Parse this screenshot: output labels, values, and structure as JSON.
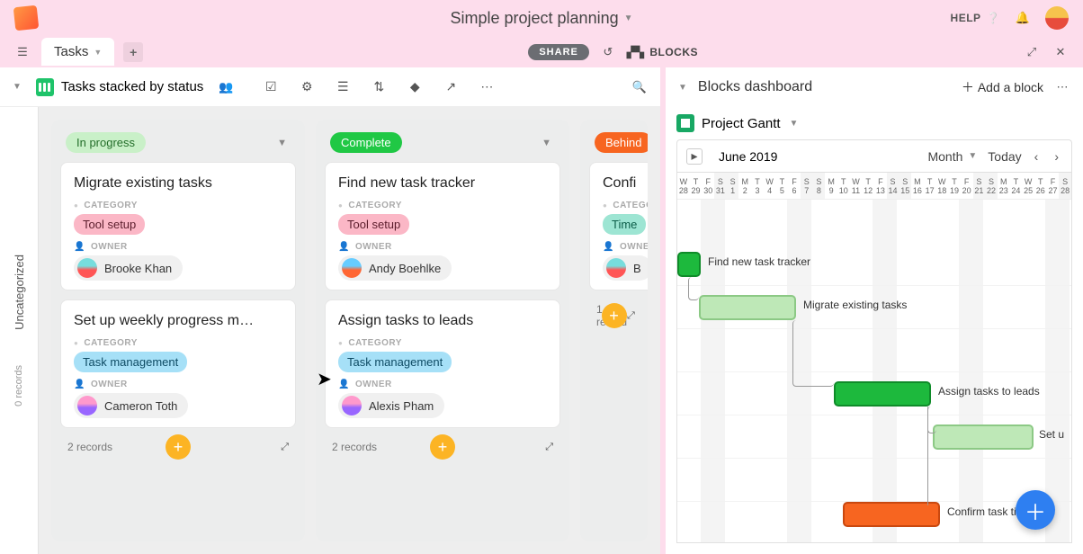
{
  "app": {
    "title": "Simple project planning",
    "help_label": "HELP"
  },
  "tabs": {
    "active": "Tasks"
  },
  "secondbar": {
    "share": "SHARE",
    "blocks": "BLOCKS"
  },
  "view": {
    "title": "Tasks stacked by status",
    "uncategorized": "Uncategorized",
    "uncat_records": "0 records"
  },
  "labels": {
    "category": "CATEGORY",
    "owner": "OWNER"
  },
  "columns": [
    {
      "status": "In progress",
      "statusClass": "pill-progress",
      "cards": [
        {
          "title": "Migrate existing tasks",
          "category": "Tool setup",
          "catClass": "cat-tool",
          "owner": "Brooke Khan",
          "avClass": "b"
        },
        {
          "title": "Set up weekly progress m…",
          "category": "Task management",
          "catClass": "cat-task",
          "owner": "Cameron Toth",
          "avClass": "c"
        }
      ],
      "footer": "2 records"
    },
    {
      "status": "Complete",
      "statusClass": "pill-complete",
      "cards": [
        {
          "title": "Find new task tracker",
          "category": "Tool setup",
          "catClass": "cat-tool",
          "owner": "Andy Boehlke",
          "avClass": "d"
        },
        {
          "title": "Assign tasks to leads",
          "category": "Task management",
          "catClass": "cat-task",
          "owner": "Alexis Pham",
          "avClass": "c"
        }
      ],
      "footer": "2 records"
    },
    {
      "status": "Behind",
      "statusClass": "pill-behind",
      "cards": [
        {
          "title": "Confi",
          "category": "Time",
          "catClass": "cat-time",
          "owner": "B",
          "avClass": "b"
        }
      ],
      "footer": "1 record"
    }
  ],
  "rightPanel": {
    "title": "Blocks dashboard",
    "add": "Add a block",
    "blockTitle": "Project Gantt",
    "dateLabel": "June 2019",
    "periodSel": "Month",
    "today": "Today",
    "days": [
      "W",
      "T",
      "F",
      "S",
      "S",
      "M",
      "T",
      "W",
      "T",
      "F",
      "S",
      "S",
      "M",
      "T",
      "W",
      "T",
      "F",
      "S",
      "S",
      "M",
      "T",
      "W",
      "T",
      "F",
      "S",
      "S",
      "M",
      "T",
      "W",
      "T",
      "F",
      "S"
    ],
    "numbers": [
      "28",
      "29",
      "30",
      "31",
      "1",
      "2",
      "3",
      "4",
      "5",
      "6",
      "7",
      "8",
      "9",
      "10",
      "11",
      "12",
      "13",
      "14",
      "15",
      "16",
      "17",
      "18",
      "19",
      "20",
      "21",
      "22",
      "23",
      "24",
      "25",
      "26",
      "27",
      "28"
    ],
    "tasks": [
      "Find new task tracker",
      "Migrate existing tasks",
      "Assign tasks to leads",
      "Set u",
      "Confirm task timelines"
    ]
  }
}
